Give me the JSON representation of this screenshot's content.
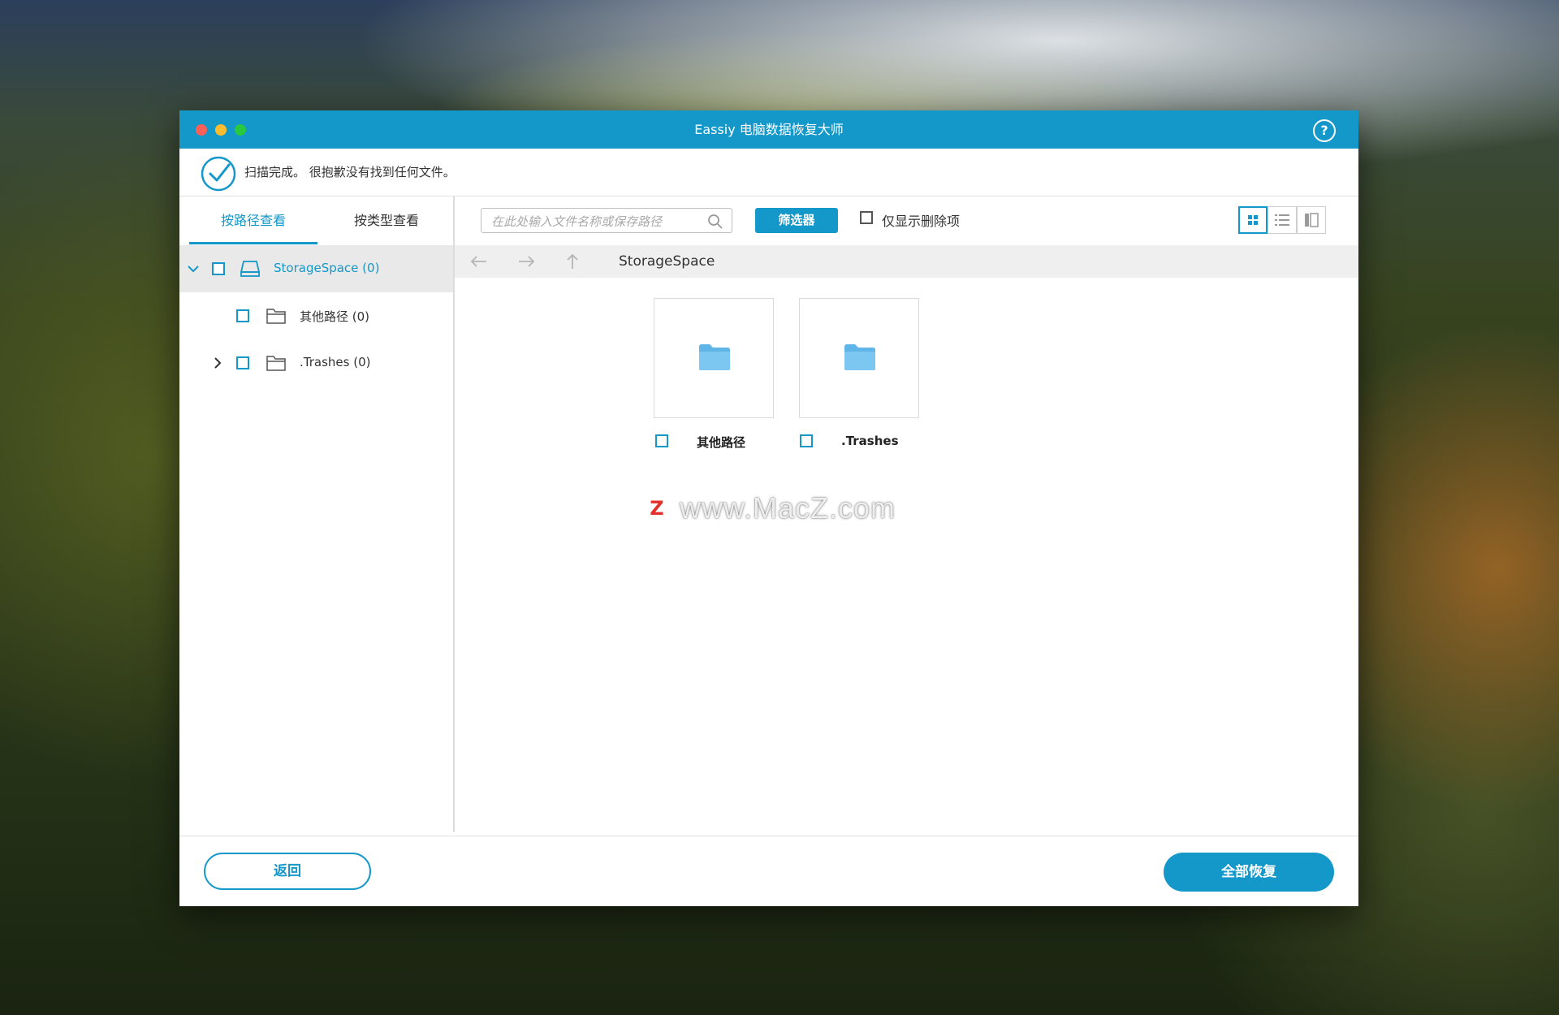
{
  "window": {
    "title": "Eassiy 电脑数据恢复大师",
    "help_glyph": "?",
    "traffic_lights": {
      "close": "#ff5f57",
      "minimize": "#febc2e",
      "maximize": "#28c840"
    }
  },
  "status": {
    "message": "扫描完成。 很抱歉没有找到任何文件。"
  },
  "sidebar": {
    "tabs": [
      {
        "label": "按路径查看",
        "active": true
      },
      {
        "label": "按类型查看",
        "active": false
      }
    ],
    "tree": [
      {
        "label": "StorageSpace (0)",
        "icon": "drive-icon",
        "expanded": true,
        "selected": true
      },
      {
        "label": "其他路径 (0)",
        "icon": "folder-icon",
        "expanded": false,
        "selected": false
      },
      {
        "label": ".Trashes (0)",
        "icon": "folder-icon",
        "expanded": false,
        "selected": false
      }
    ]
  },
  "toolbar": {
    "search_placeholder": "在此处输入文件名称或保存路径",
    "filter_label": "筛选器",
    "only_deleted_label": "仅显示删除项",
    "view_modes": [
      "grid-view-icon",
      "list-view-icon",
      "column-view-icon"
    ],
    "active_view": "grid-view-icon"
  },
  "navigation": {
    "path": "StorageSpace"
  },
  "files": [
    {
      "name": "其他路径",
      "icon": "folder-icon"
    },
    {
      "name": ".Trashes",
      "icon": "folder-icon"
    }
  ],
  "watermark": {
    "badge": "Z",
    "text": "www.MacZ.com"
  },
  "footer": {
    "back_label": "返回",
    "recover_all_label": "全部恢复"
  },
  "colors": {
    "accent": "#1497c9",
    "nav_bg": "#efeff0",
    "selected_row": "#e9e9ea"
  }
}
